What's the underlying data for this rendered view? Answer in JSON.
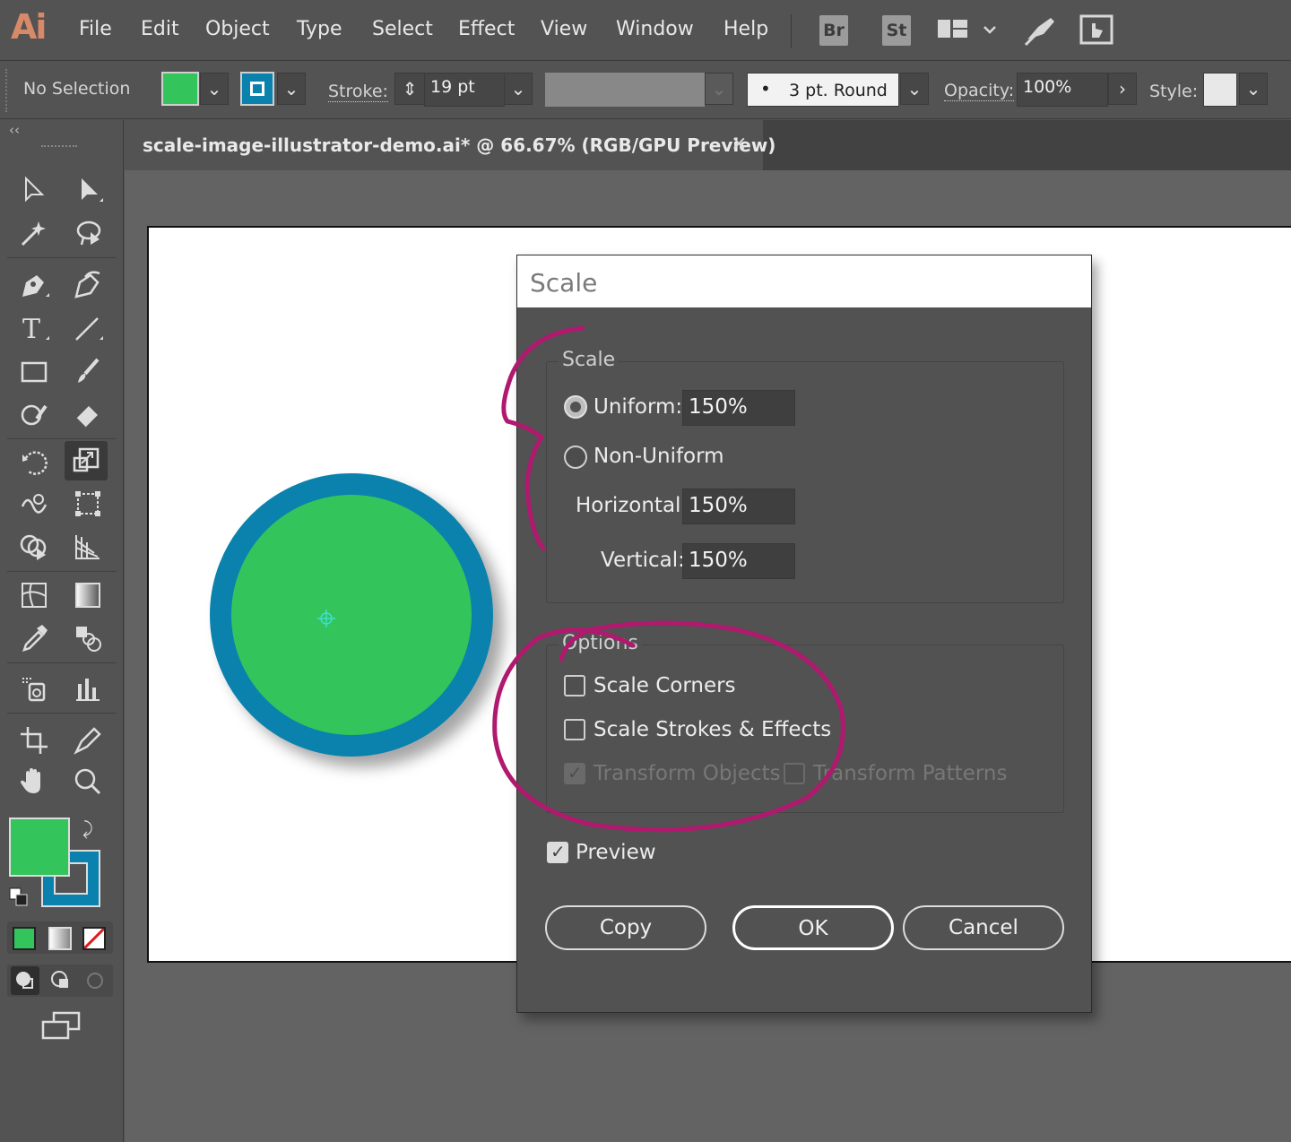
{
  "app": {
    "logo": "Ai"
  },
  "menu": [
    "File",
    "Edit",
    "Object",
    "Type",
    "Select",
    "Effect",
    "View",
    "Window",
    "Help"
  ],
  "app_badges": [
    "Br",
    "St"
  ],
  "control_bar": {
    "selection_label": "No Selection",
    "fill_color": "#33c45c",
    "stroke_color": "#0a82ad",
    "stroke_label": "Stroke:",
    "stroke_value": "19 pt",
    "brush_label": "3 pt. Round",
    "opacity_label": "Opacity:",
    "opacity_value": "100%",
    "style_label": "Style:"
  },
  "document_tab": {
    "title": "scale-image-illustrator-demo.ai* @ 66.67% (RGB/GPU Preview)",
    "close": "×"
  },
  "toolbar": {
    "collapse": "‹‹",
    "fill_color": "#33c45c",
    "stroke_color": "#0a82ad"
  },
  "artwork": {
    "fill": "#33c45c",
    "stroke": "#0a82ad"
  },
  "dialog": {
    "title": "Scale",
    "scale_group": "Scale",
    "uniform_label": "Uniform:",
    "uniform_value": "150%",
    "uniform_selected": true,
    "nonuniform_label": "Non-Uniform",
    "horizontal_label": "Horizontal:",
    "horizontal_value": "150%",
    "vertical_label": "Vertical:",
    "vertical_value": "150%",
    "options_group": "Options",
    "scale_corners_label": "Scale Corners",
    "scale_corners_checked": false,
    "scale_strokes_label": "Scale Strokes & Effects",
    "scale_strokes_checked": false,
    "transform_objects_label": "Transform Objects",
    "transform_objects_checked": true,
    "transform_patterns_label": "Transform Patterns",
    "transform_patterns_checked": false,
    "preview_label": "Preview",
    "preview_checked": true,
    "copy_button": "Copy",
    "ok_button": "OK",
    "cancel_button": "Cancel"
  },
  "annotation_color": "#b0196e"
}
